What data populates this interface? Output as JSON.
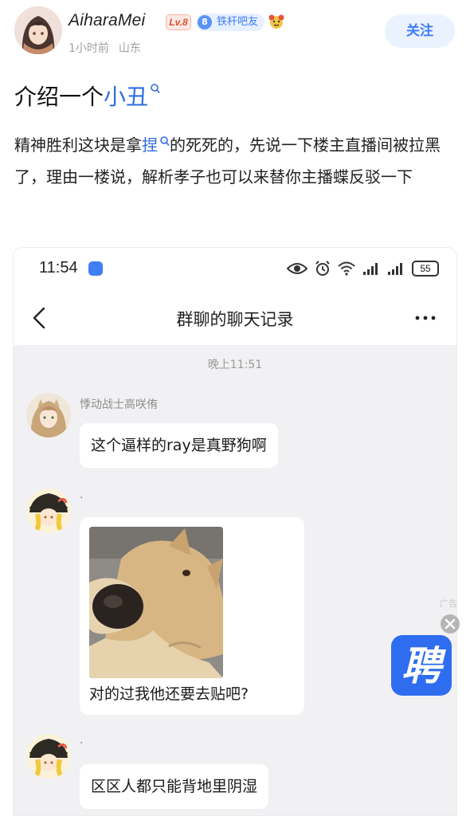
{
  "post": {
    "username": "AiharaMei",
    "level": "Lv.8",
    "fan_level": "8",
    "fan_badge": "铁杆吧友",
    "time": "1小时前",
    "location": "山东",
    "follow_label": "关注",
    "title_prefix": "介绍一个",
    "title_keyword": "小丑",
    "body_part1": "精神胜利这块是拿",
    "body_keyword": "捏",
    "body_part2": "的死死的，先说一下楼主直播间被拉黑了，理由一楼说，解析孝子也可以来替你主播蝶反驳一下"
  },
  "screenshot": {
    "status_time": "11:54",
    "battery": "55",
    "chat_title": "群聊的聊天记录",
    "date_separator": "晚上11:51",
    "messages": [
      {
        "sender": "悸动战士高咲侑",
        "text": "这个逼样的ray是真野狗啊"
      },
      {
        "sender": "·",
        "caption": "对的过我他还要去贴吧?"
      },
      {
        "sender": "·",
        "text": "区区人都只能背地里阴湿"
      }
    ]
  },
  "ad": {
    "label": "广告",
    "logo_char": "聘"
  },
  "colors": {
    "accent": "#2f6ce0",
    "follow_bg": "#eaf2ff",
    "chat_bg": "#f1f1f3",
    "ad_blue": "#2e6cf0"
  },
  "icons": [
    "search-keyword-icon",
    "back-chevron-icon",
    "more-icon",
    "eye-icon",
    "alarm-icon",
    "wifi-icon",
    "signal-icon",
    "battery-icon",
    "close-icon"
  ]
}
